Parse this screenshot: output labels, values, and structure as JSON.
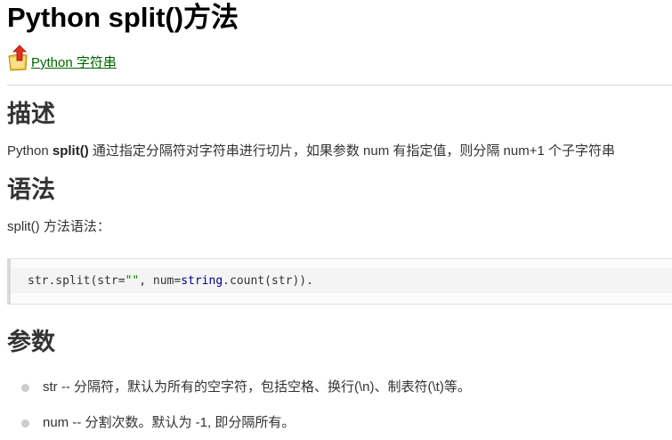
{
  "page": {
    "title": "Python split()方法",
    "back_link": "Python 字符串",
    "icons": {
      "back": "up-arrow-folder-icon",
      "bullet": "bullet-dot-icon"
    },
    "colors": {
      "link": "#006600",
      "text": "#333333",
      "code_string": "#008800",
      "code_keyword": "#000088"
    }
  },
  "sections": {
    "description": {
      "heading": "描述",
      "text_before": "Python ",
      "text_bold": "split()",
      "text_after": " 通过指定分隔符对字符串进行切片，如果参数 num 有指定值，则分隔 num+1 个子字符串"
    },
    "syntax": {
      "heading": "语法",
      "intro": "split() 方法语法：",
      "code": {
        "p1": "str.split(str=",
        "p2": "\"\"",
        "p3": ", num=",
        "p4": "string",
        "p5": ".count(str))."
      }
    },
    "params": {
      "heading": "参数",
      "items": [
        "str -- 分隔符，默认为所有的空字符，包括空格、换行(\\n)、制表符(\\t)等。",
        "num -- 分割次数。默认为 -1, 即分隔所有。"
      ]
    }
  }
}
